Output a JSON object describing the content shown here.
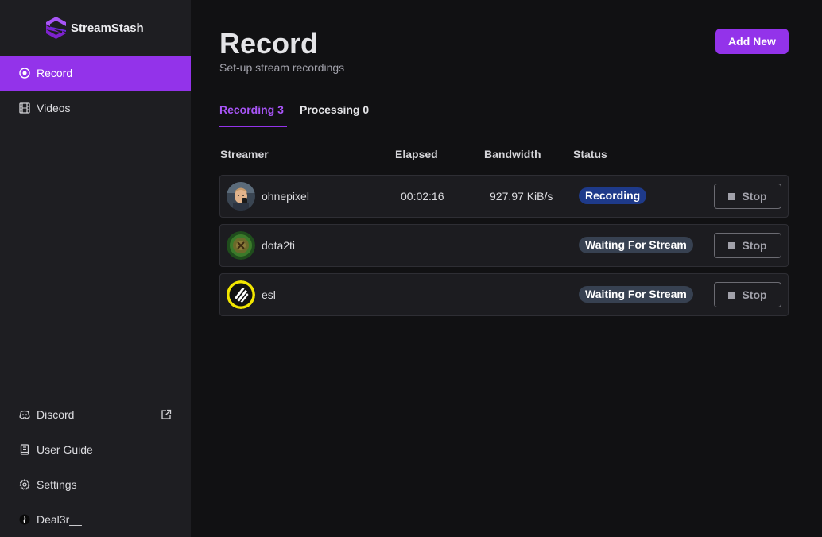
{
  "brand": {
    "name": "StreamStash"
  },
  "nav": {
    "top": [
      {
        "label": "Record",
        "icon": "record-icon",
        "active": true
      },
      {
        "label": "Videos",
        "icon": "film-icon",
        "active": false
      }
    ],
    "bottom": [
      {
        "label": "Discord",
        "icon": "discord-icon",
        "external": true
      },
      {
        "label": "User Guide",
        "icon": "book-icon"
      },
      {
        "label": "Settings",
        "icon": "gear-icon"
      },
      {
        "label": "Deal3r__",
        "icon": "user-avatar-icon"
      }
    ]
  },
  "page": {
    "title": "Record",
    "subtitle": "Set-up stream recordings",
    "add_button": "Add New"
  },
  "tabs": [
    {
      "label": "Recording 3",
      "active": true
    },
    {
      "label": "Processing 0",
      "active": false
    }
  ],
  "table": {
    "columns": [
      "Streamer",
      "Elapsed",
      "Bandwidth",
      "Status"
    ],
    "rows": [
      {
        "streamer": "ohnepixel",
        "elapsed": "00:02:16",
        "bandwidth": "927.97 KiB/s",
        "status": "Recording",
        "action": "Stop"
      },
      {
        "streamer": "dota2ti",
        "elapsed": "",
        "bandwidth": "",
        "status": "Waiting For Stream",
        "action": "Stop"
      },
      {
        "streamer": "esl",
        "elapsed": "",
        "bandwidth": "",
        "status": "Waiting For Stream",
        "action": "Stop"
      }
    ]
  },
  "colors": {
    "accent": "#9333ea",
    "sidebar_bg": "#1e1e22",
    "main_bg": "#111113",
    "recording_badge": "#1e3a8a",
    "waiting_badge": "#374151"
  }
}
